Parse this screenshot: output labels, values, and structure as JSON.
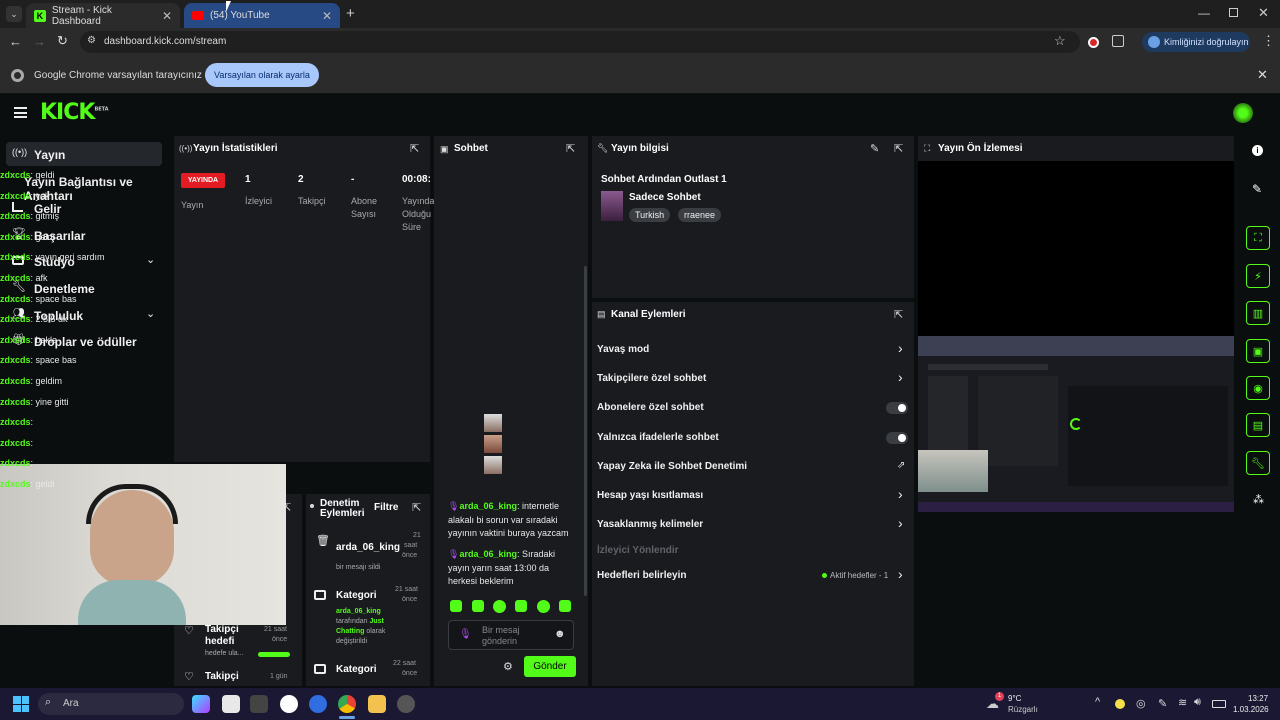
{
  "browser": {
    "tabs": [
      {
        "label": "Stream - Kick Dashboard"
      },
      {
        "label": "(54) YouTube"
      }
    ],
    "address": "dashboard.kick.com/stream",
    "profile_label": "Kimliğinizi doğrulayın",
    "infobar_text": "Google Chrome varsayılan tarayıcınız değil",
    "infobar_button": "Varsayılan olarak ayarla"
  },
  "kick": {
    "logo": "KICK",
    "beta": "BETA",
    "sidebar": [
      {
        "label": "Yayın",
        "icon": "broadcast-icon"
      },
      {
        "label": "Yayın Bağlantısı ve Anahtarı"
      },
      {
        "label": "Gelir",
        "icon": "chart-icon"
      },
      {
        "label": "Başarılar",
        "icon": "trophy-icon"
      },
      {
        "label": "Stüdyo",
        "icon": "studio-icon"
      },
      {
        "label": "Denetleme",
        "icon": "wrench-icon"
      },
      {
        "label": "Topluluk",
        "icon": "community-icon"
      },
      {
        "label": "Droplar ve ödüller",
        "icon": "gift-icon"
      }
    ],
    "stats": {
      "title": "Yayın İstatistikleri",
      "live": "YAYINDA",
      "status_label": "Yayın",
      "viewers_value": "1",
      "viewers_label": "İzleyici",
      "followers_value": "2",
      "followers_label": "Takipçi",
      "subs_value": "-",
      "subs_label1": "Abone",
      "subs_label2": "Sayısı",
      "duration_value": "00:08:",
      "duration_label1": "Yayında",
      "duration_label2": "Olduğu",
      "duration_label3": "Süre"
    },
    "chat": {
      "title": "Sohbet",
      "messages": [
        {
          "user": "zdxcds",
          "text": ": geldi"
        },
        {
          "user": "zdxcds",
          "text": ": yok"
        },
        {
          "user": "zdxcds",
          "text": ": gitmiş"
        },
        {
          "user": "zdxcds",
          "text": ": geldi"
        },
        {
          "user": "zdxcds",
          "text": ": yayın geri sardım"
        },
        {
          "user": "zdxcds",
          "text": ": afk"
        },
        {
          "user": "zdxcds",
          "text": ": space bas"
        },
        {
          "user": "zdxcds",
          "text": ": 2.5 5 dk"
        },
        {
          "user": "zdxcds",
          "text": ": bekle"
        },
        {
          "user": "zdxcds",
          "text": ": space bas"
        },
        {
          "user": "zdxcds",
          "text": ": geldim"
        },
        {
          "user": "zdxcds",
          "text": ": yine gitti"
        },
        {
          "user": "zdxcds",
          "text": ":"
        },
        {
          "user": "zdxcds",
          "text": ":"
        },
        {
          "user": "zdxcds",
          "text": ":"
        },
        {
          "user": "zdxcds",
          "text": ": geldi"
        }
      ],
      "msg_a_user": "arda_06_king",
      "msg_a_line1": ": internetle",
      "msg_a_line2": "alakalı bi sorun var sıradaki",
      "msg_a_line3": "yayının vaktini buraya yazcam",
      "msg_b_user": "arda_06_king",
      "msg_b_line1": ": Sıradaki",
      "msg_b_line2": "yayın yarın saat 13:00 da",
      "msg_b_line3": "herkesi beklerim",
      "input_placeholder1": "Bir mesaj",
      "input_placeholder2": "gönderin",
      "send_label": "Gönder"
    },
    "stream_info": {
      "title": "Yayın bilgisi",
      "stream_title": "Sohbet Ardından Outlast 1",
      "category": "Sadece Sohbet",
      "tags": [
        "Turkish",
        "rraenee"
      ]
    },
    "channel_actions": {
      "title": "Kanal Eylemleri",
      "items": [
        {
          "label": "Yavaş mod"
        },
        {
          "label": "Takipçilere özel sohbet"
        },
        {
          "label": "Abonelere özel sohbet"
        },
        {
          "label": "Yalnızca ifadelerle sohbet"
        },
        {
          "label": "Yapay Zeka ile Sohbet Denetimi"
        },
        {
          "label": "Hesap yaşı kısıtlaması"
        },
        {
          "label": "Yasaklanmış kelimeler"
        },
        {
          "label": "İzleyici Yönlendir"
        },
        {
          "label": "Hedefleri belirleyin"
        }
      ],
      "goal_status": "Aktif hedefler - 1"
    },
    "preview": {
      "title": "Yayın Ön İzlemesi"
    },
    "mod_actions": {
      "title1": "Denetim",
      "title2": "Eylemleri",
      "filter": "Filtre",
      "entries": [
        {
          "title": "arda_06_king",
          "desc": "bir mesajı sildi",
          "time1": "21",
          "time2": "saat",
          "time3": "önce"
        },
        {
          "title": "Kategori",
          "desc_user": "arda_06_king",
          "desc1": "tarafından",
          "desc_cat1": "Just",
          "desc_cat2": "Chatting",
          "desc2": "olarak",
          "desc3": "değiştirildi",
          "time1": "21 saat",
          "time2": "önce"
        },
        {
          "title": "Kategori",
          "time1": "22 saat",
          "time2": "önce"
        }
      ]
    },
    "goal_card": {
      "title1": "Takipçi",
      "title2": "hedefi",
      "desc": "hedefe ula...",
      "time1": "21 saat",
      "time2": "önce",
      "next": "Takipçi",
      "next_time": "1 gün"
    }
  },
  "taskbar": {
    "search": "Ara",
    "weather_temp": "9°C",
    "weather_desc": "Rüzgarlı",
    "weather_badge": "1",
    "time": "13:27",
    "date": "1.03.2026"
  },
  "colors": {
    "accent": "#53fc18",
    "live": "#e31b23",
    "panel": "#191b1f"
  }
}
